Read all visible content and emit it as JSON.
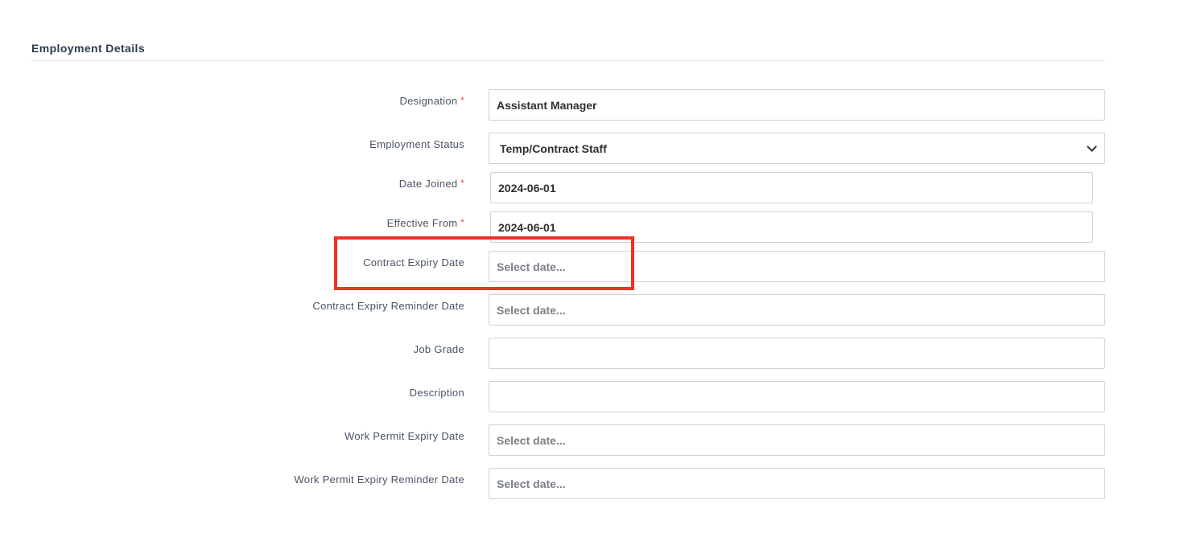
{
  "section": {
    "title": "Employment Details"
  },
  "fields": [
    {
      "label": "Designation",
      "required": true,
      "value": "Assistant Manager",
      "placeholder": ""
    },
    {
      "label": "Employment Status",
      "required": false,
      "value": "Temp/Contract Staff",
      "placeholder": ""
    },
    {
      "label": "Date Joined",
      "required": true,
      "value": "2024-06-01",
      "placeholder": ""
    },
    {
      "label": "Effective From",
      "required": true,
      "value": "2024-06-01",
      "placeholder": ""
    },
    {
      "label": "Contract Expiry Date",
      "required": false,
      "value": "",
      "placeholder": "Select date..."
    },
    {
      "label": "Contract Expiry Reminder Date",
      "required": false,
      "value": "",
      "placeholder": "Select date..."
    },
    {
      "label": "Job Grade",
      "required": false,
      "value": "",
      "placeholder": ""
    },
    {
      "label": "Description",
      "required": false,
      "value": "",
      "placeholder": ""
    },
    {
      "label": "Work Permit Expiry Date",
      "required": false,
      "value": "",
      "placeholder": "Select date..."
    },
    {
      "label": "Work Permit Expiry Reminder Date",
      "required": false,
      "value": "",
      "placeholder": "Select date..."
    }
  ],
  "required_marker": "*",
  "colors": {
    "required": "#e53935",
    "highlight": "#ee3124",
    "border": "#ccd2d9"
  }
}
